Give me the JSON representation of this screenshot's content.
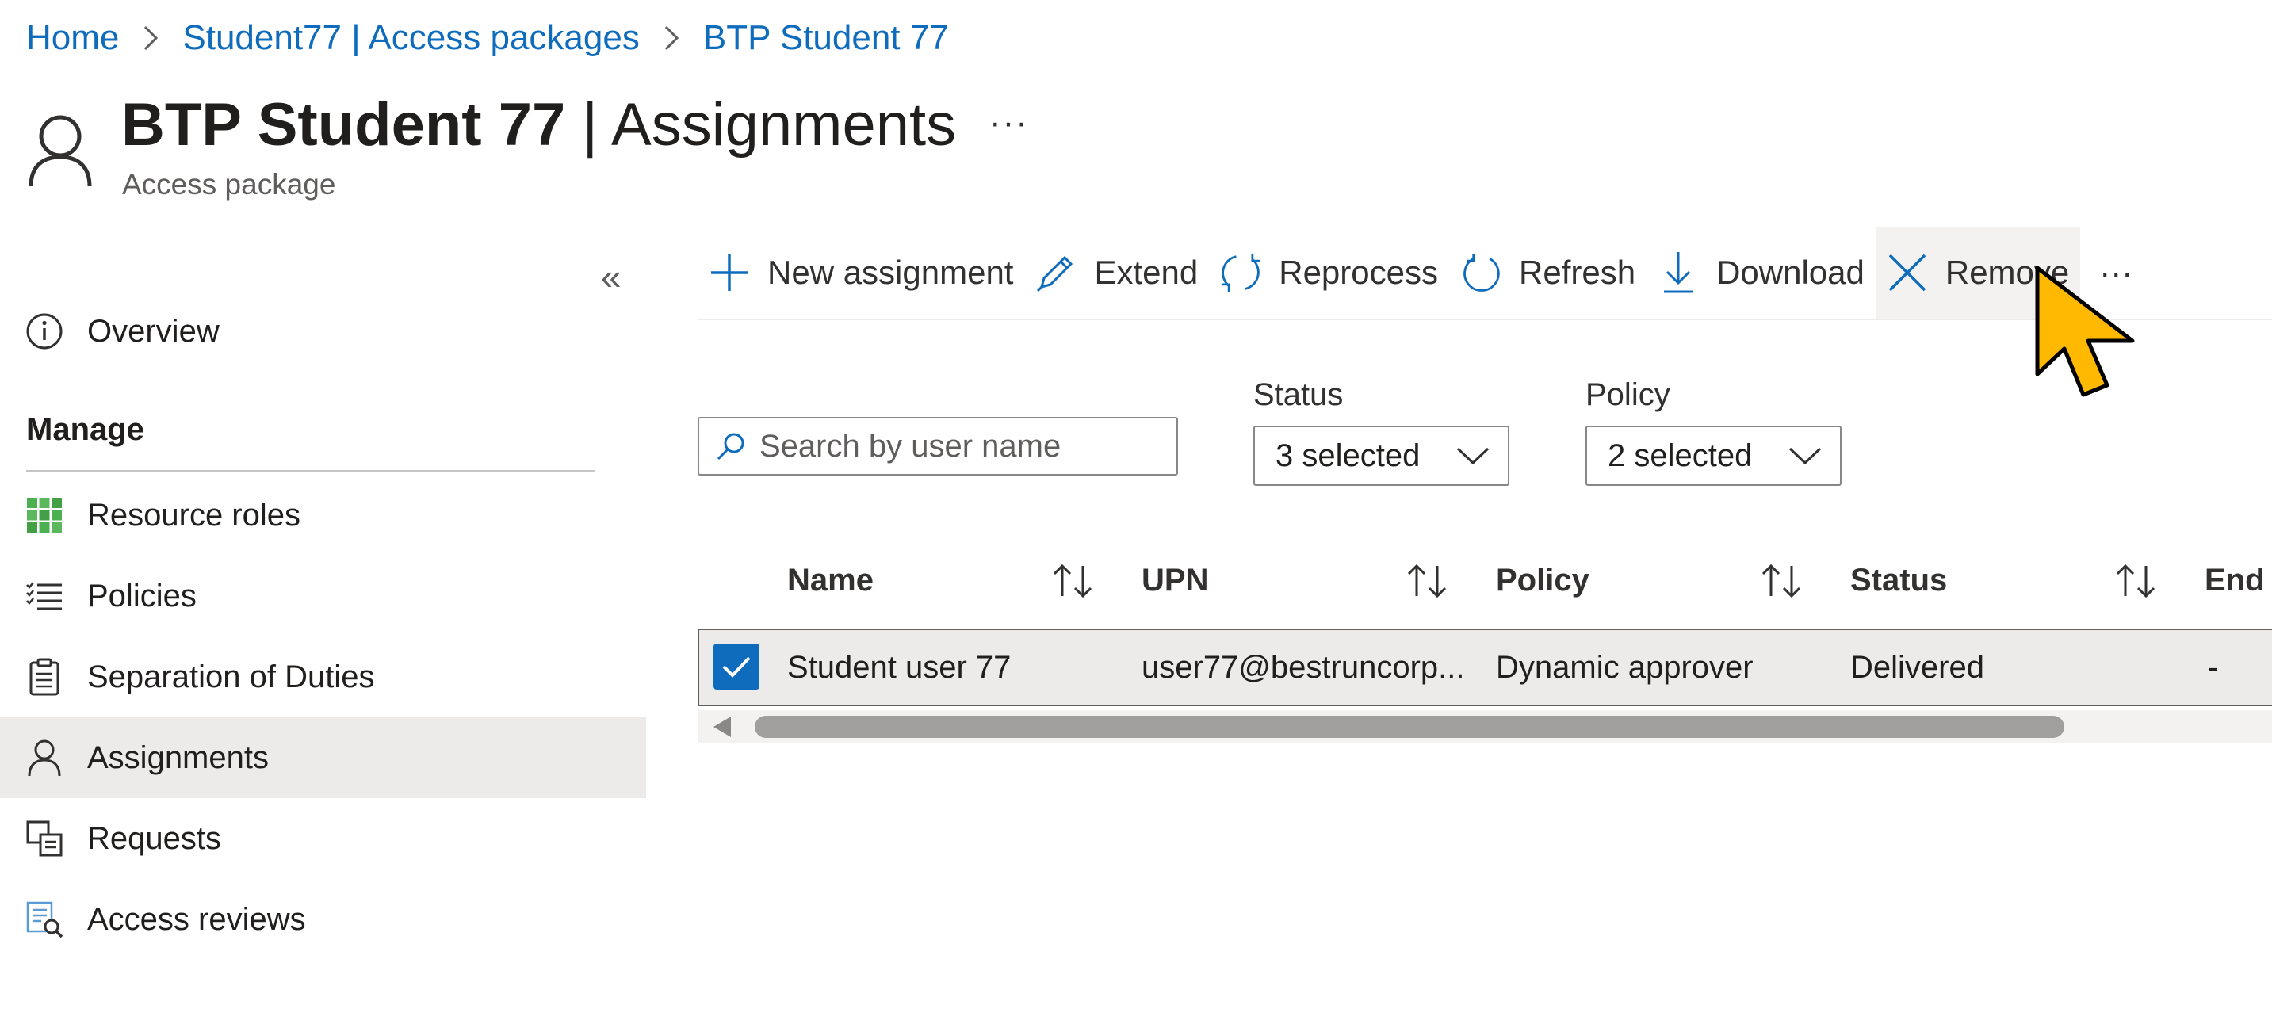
{
  "breadcrumb": {
    "items": [
      {
        "label": "Home"
      },
      {
        "label": "Student77 | Access packages"
      },
      {
        "label": "BTP Student 77"
      }
    ]
  },
  "header": {
    "title_bold": "BTP Student 77",
    "title_rest": " | Assignments",
    "more": "···",
    "subtitle": "Access package"
  },
  "sidebar": {
    "collapse": "«",
    "overview": "Overview",
    "section_manage": "Manage",
    "items": [
      {
        "label": "Resource roles",
        "icon": "grid-icon"
      },
      {
        "label": "Policies",
        "icon": "checklist-icon"
      },
      {
        "label": "Separation of Duties",
        "icon": "clipboard-icon"
      },
      {
        "label": "Assignments",
        "icon": "person-icon",
        "active": true
      },
      {
        "label": "Requests",
        "icon": "requests-icon"
      },
      {
        "label": "Access reviews",
        "icon": "access-review-icon"
      }
    ]
  },
  "toolbar": {
    "new_assignment": "New assignment",
    "extend": "Extend",
    "reprocess": "Reprocess",
    "refresh": "Refresh",
    "download": "Download",
    "remove": "Remove",
    "more": "···"
  },
  "filters": {
    "search_placeholder": "Search by user name",
    "status_label": "Status",
    "status_value": "3 selected",
    "policy_label": "Policy",
    "policy_value": "2 selected"
  },
  "table": {
    "columns": [
      "Name",
      "UPN",
      "Policy",
      "Status",
      "End"
    ],
    "rows": [
      {
        "name": "Student user 77",
        "upn": "user77@bestruncorp...",
        "policy": "Dynamic approver",
        "status": "Delivered",
        "end": "-",
        "selected": true
      }
    ]
  },
  "colors": {
    "accent": "#0f6cbd",
    "selected_row": "#edebe9",
    "cursor": "#ffb900"
  }
}
